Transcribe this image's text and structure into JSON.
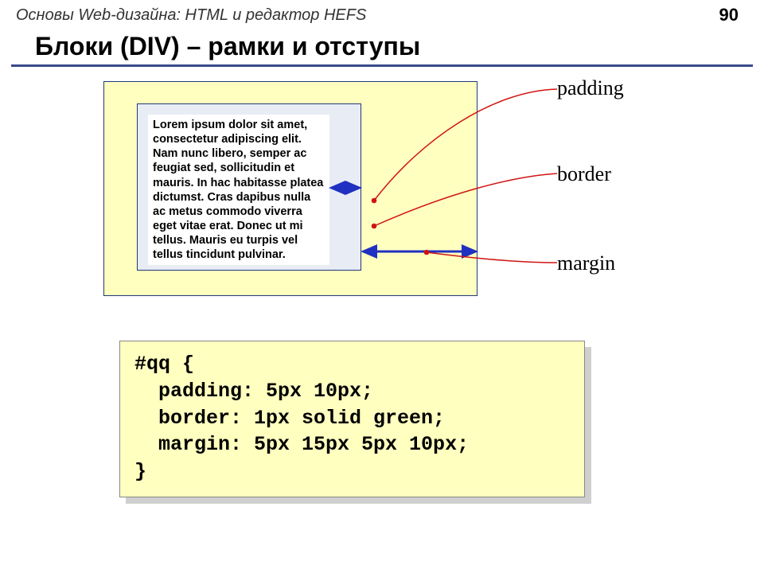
{
  "header": {
    "subject": "Основы Web-дизайна: HTML и редактор HEFS",
    "page_number": "90"
  },
  "title": "Блоки (DIV) – рамки и отступы",
  "diagram": {
    "lorem": "Lorem ipsum dolor sit amet, consectetur adipiscing elit. Nam nunc libero, semper ac feugiat sed, sollicitudin et mauris. In hac habitasse platea dictumst. Cras dapibus nulla ac metus commodo viverra eget vitae erat. Donec ut mi tellus. Mauris eu turpis vel tellus tincidunt pulvinar.",
    "labels": {
      "padding": "padding",
      "border": "border",
      "margin": "margin"
    }
  },
  "code": "#qq {\n  padding: 5px 10px;\n  border: 1px solid green;\n  margin: 5px 15px 5px 10px;\n}"
}
